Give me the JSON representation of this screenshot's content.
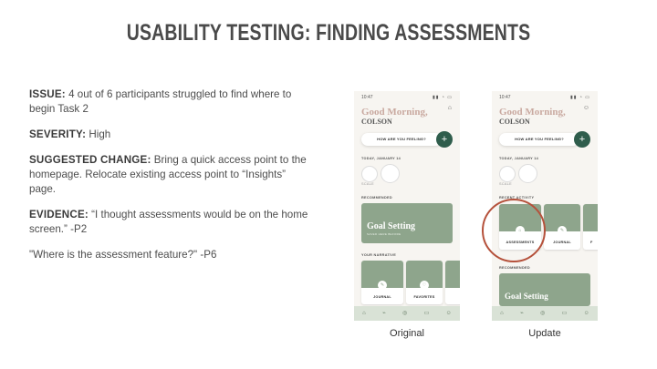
{
  "title": "USABILITY TESTING: FINDING ASSESSMENTS",
  "issue": {
    "label": "ISSUE:",
    "text": "4 out of 6 participants struggled to find where to begin Task 2"
  },
  "severity": {
    "label": "SEVERITY:",
    "text": "High"
  },
  "suggested_change": {
    "label": "SUGGESTED CHANGE:",
    "text": "Bring a quick access point to the homepage. Relocate existing access point to “Insights” page."
  },
  "evidence": {
    "label": "EVIDENCE:",
    "text": "“I thought assessments would be on the home screen.” -P2"
  },
  "quote2": "\"Where is the assessment feature?\" -P6",
  "phones": {
    "original": {
      "time": "10:47",
      "greeting": "Good Morning,",
      "name": "COLSON",
      "feel_prompt": "HOW ARE YOU FEELING?",
      "today_label": "TODAY, JANUARY 14",
      "mood_label": "SCALE",
      "recommended_label": "RECOMMENDED",
      "card_title": "Goal Setting",
      "card_sub": "SAVED HERE BEFORE",
      "narrative_label": "YOUR NARRATIVE",
      "tile1": "JOURNAL",
      "tile2": "FAVORITES",
      "caption": "Original"
    },
    "update": {
      "time": "10:47",
      "greeting": "Good Morning,",
      "name": "COLSON",
      "feel_prompt": "HOW ARE YOU FEELING?",
      "today_label": "TODAY, JANUARY 14",
      "mood_label": "SCALE",
      "recent_label": "RECENT ACTIVITY",
      "tile1": "ASSESSMENTS",
      "tile2": "JOURNAL",
      "tile3": "F",
      "recommended_label": "RECOMMENDED",
      "card_title": "Goal Setting",
      "caption": "Update"
    }
  },
  "nav_labels": [
    "HOME",
    "INSIGHTS",
    "EXPLORE",
    "MESSAGES",
    "ACCOUNT"
  ],
  "colors": {
    "accent_green": "#2f5d4c",
    "sage": "#8ea58c",
    "highlight_circle": "#b5513b"
  }
}
